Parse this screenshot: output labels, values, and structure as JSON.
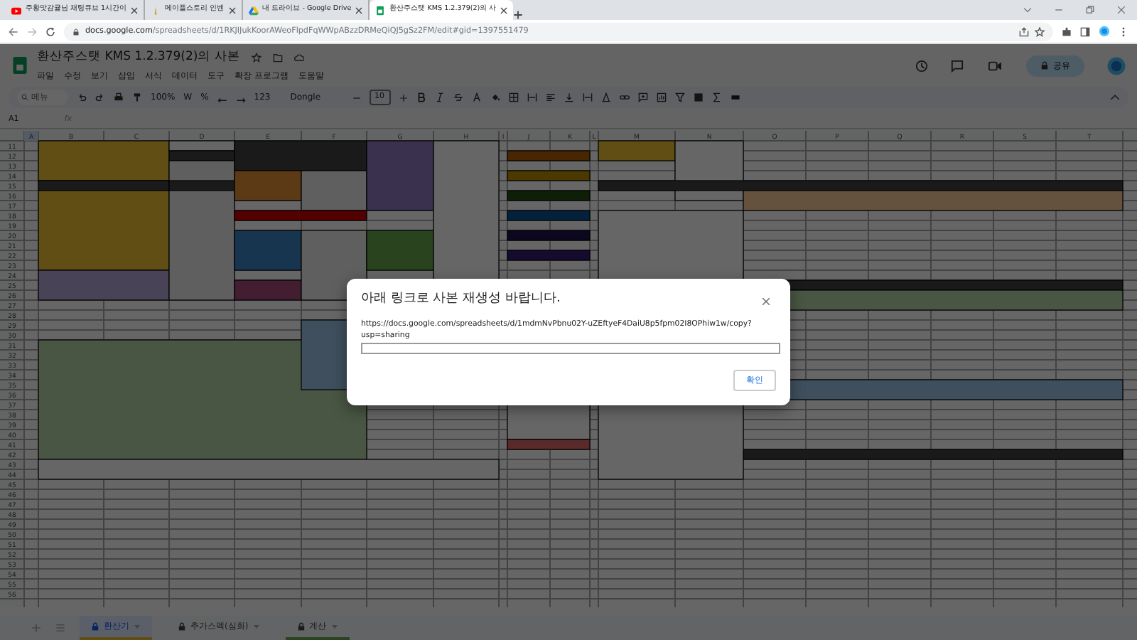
{
  "browser_tabs": [
    {
      "title": "주황맛감귤님 채팅큐브 1시간이",
      "selected": false,
      "kind": "video"
    },
    {
      "title": "메이플스토리 인벤",
      "selected": false,
      "kind": "game"
    },
    {
      "title": "내 드라이브 - Google Drive",
      "selected": false,
      "kind": "drive"
    },
    {
      "title": "환산주스탯 KMS 1.2.379(2)의 사",
      "selected": true,
      "kind": "sheets"
    }
  ],
  "address_bar": {
    "url_host": "docs.google.com",
    "url_path": "/spreadsheets/d/1RKJIJukKoorAWeoFlpdFqWWpABzzDRMeQiQJ5gSz2FM/edit#gid=1397551479"
  },
  "document": {
    "title": "환산주스탯 KMS 1.2.379(2)의 사본",
    "menus": [
      "파일",
      "수정",
      "보기",
      "삽입",
      "서식",
      "데이터",
      "도구",
      "확장 프로그램",
      "도움말"
    ],
    "share_label": "공유"
  },
  "toolbar": {
    "search_placeholder": "메뉴",
    "zoom": "100%",
    "currency": "W",
    "percent": "%",
    "format_123": "123",
    "font": "Dongle",
    "font_size": "10"
  },
  "formula_bar": {
    "cell_ref": "A1",
    "fx": "fx"
  },
  "sheet": {
    "columns": [
      "A",
      "B",
      "C",
      "D",
      "E",
      "F",
      "G",
      "H",
      "I",
      "J",
      "K",
      "L",
      "M",
      "N",
      "O",
      "P",
      "Q",
      "R",
      "S",
      "T"
    ],
    "rows": [
      "11",
      "12",
      "13",
      "14",
      "15",
      "16",
      "17",
      "18",
      "19",
      "20",
      "21",
      "22",
      "23",
      "24",
      "25",
      "26",
      "27",
      "28",
      "29",
      "30",
      "31",
      "32",
      "33",
      "34",
      "35",
      "36",
      "37",
      "38",
      "39",
      "40",
      "41",
      "42",
      "43",
      "44",
      "45",
      "46",
      "47",
      "48",
      "49",
      "50",
      "51",
      "52",
      "53",
      "54",
      "55",
      "56"
    ]
  },
  "sheet_tabs": [
    {
      "label": "환산기",
      "selected": true,
      "color": "#614e14"
    },
    {
      "label": "추가스펙(심화)",
      "selected": false
    },
    {
      "label": "계산",
      "selected": false,
      "color": "#2a4320"
    }
  ],
  "dialog": {
    "title": "아래 링크로 사본 재생성 바랍니다.",
    "link": "https://docs.google.com/spreadsheets/d/1mdmNvPbnu02Y-uZEftyeF4DaiU8p5fpm02I8OPhiw1w/copy?usp=sharing",
    "confirm": "확인"
  }
}
